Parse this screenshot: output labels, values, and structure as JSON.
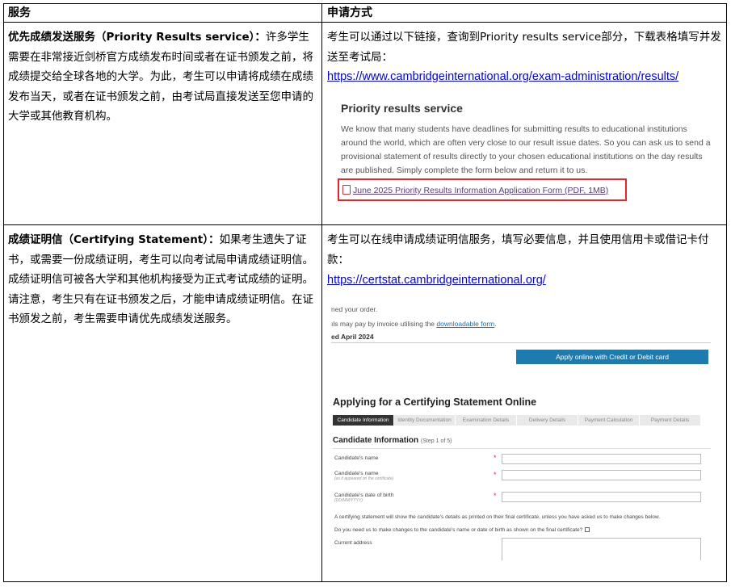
{
  "header": {
    "col1": "服务",
    "col2": "申请方式"
  },
  "row1": {
    "left_bold": "优先成绩发送服务（Priority Results service）：",
    "left_text": "许多学生需要在非常接近剑桥官方成绩发布时间或者在证书颁发之前，将成绩提交给全球各地的大学。为此，考生可以申请将成绩在成绩发布当天，或者在证书颁发之前，由考试局直接发送至您申请的大学或其他教育机构。",
    "right_text": "考生可以通过以下链接，查询到Priority results service部分，下载表格填写并发送至考试局：",
    "right_link": "https://www.cambridgeinternational.org/exam-administration/results/",
    "shot": {
      "title": "Priority results service",
      "body": "We know that many students have deadlines for submitting results to educational institutions around the world, which are often very close to our result issue dates. So you can ask us to send a provisional statement of results directly to your chosen educational institutions on the day results are published. Simply complete the form below and return it to us.",
      "link": "June 2025 Priority Results Information Application Form (PDF, 1MB)",
      "icon": "pdf-icon",
      "highlight_color": "#e8262a"
    }
  },
  "row2": {
    "left_bold": "成绩证明信（Certifying Statement）：",
    "left_text": "如果考生遗失了证书，或需要一份成绩证明，考生可以向考试局申请成绩证明信。成绩证明信可被各大学和其他机构接受为正式考试成绩的证明。请注意，考生只有在证书颁发之后，才能申请成绩证明信。在证书颁发之前，考生需要申请优先成绩发送服务。",
    "right_text": "考生可以在线申请成绩证明信服务，填写必要信息，并且使用信用卡或借记卡付款：",
    "right_link": "https://certstat.cambridgeinternational.org/",
    "shot": {
      "frag1": "ned your order.",
      "frag2_pre": "ıls may pay by invoice utilising the ",
      "frag2_link": "downloadable form",
      "frag2_post": ".",
      "date": "ed April 2024",
      "button": "Apply online with Credit or Debit card",
      "heading": "Applying for a Certifying Statement Online",
      "steps": [
        "Candidate Information",
        "Identity Documentation",
        "Examination Details",
        "Delivery Details",
        "Payment Calculation",
        "Payment Details"
      ],
      "section": "Candidate Information",
      "section_step": "(Step 1 of 5)",
      "fields": [
        {
          "label": "Candidate's name",
          "note": ""
        },
        {
          "label": "Candidate's name",
          "note": "(as it appeared on the certificate)"
        },
        {
          "label": "Candidate's date of birth",
          "note": "(DD/MM/YYYY)"
        }
      ],
      "required_mark": "*",
      "info_text": "A certifying statement will show the candidate's details as printed on their final certificate, unless you have asked us to make changes below.",
      "question": "Do you need us to make changes to the candidate's name or date of birth as shown on the final certificate?",
      "address_label": "Current address",
      "button_color": "#1e7bb0"
    }
  }
}
